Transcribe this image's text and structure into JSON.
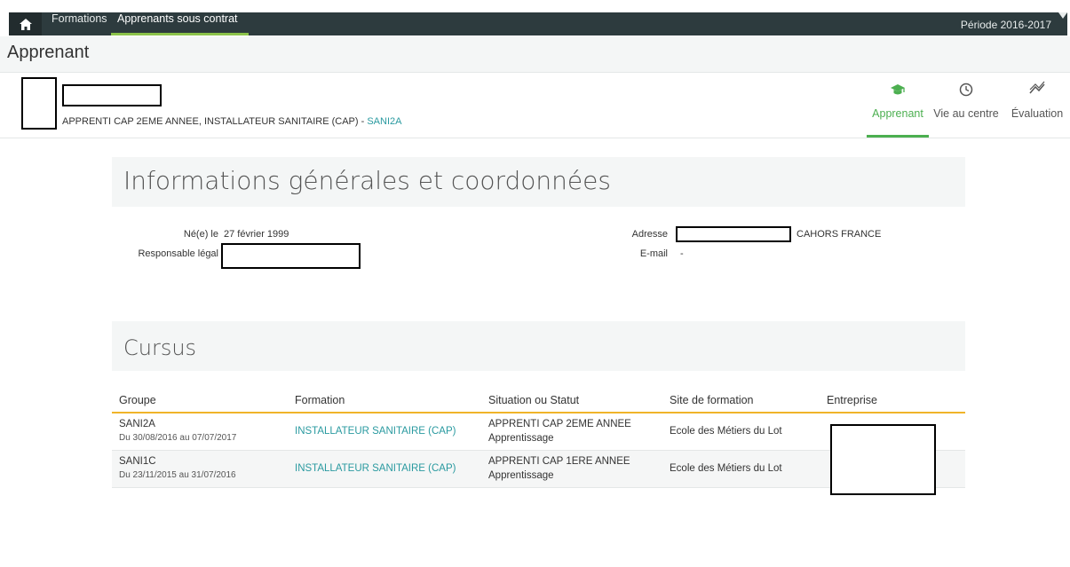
{
  "topnav": {
    "items": [
      "Formations",
      "Apprenants sous contrat"
    ],
    "period": "Période 2016-2017"
  },
  "page_title": "Apprenant",
  "learner": {
    "course_text": "APPRENTI CAP 2EME ANNEE, INSTALLATEUR SANITAIRE (CAP) - ",
    "group_code": "SANI2A"
  },
  "tabs": [
    {
      "label": "Apprenant",
      "icon": "graduation-cap-icon"
    },
    {
      "label": "Vie au centre",
      "icon": "clock-icon"
    },
    {
      "label": "Évaluation",
      "icon": "trend-icon"
    }
  ],
  "info": {
    "title": "Informations générales et coordonnées",
    "birth_label": "Né(e) le",
    "birth_value": "27 février 1999",
    "guardian_label": "Responsable légal",
    "address_label": "Adresse",
    "address_suffix": "CAHORS FRANCE",
    "email_label": "E-mail",
    "email_value": "-"
  },
  "cursus": {
    "title": "Cursus",
    "columns": [
      "Groupe",
      "Formation",
      "Situation ou Statut",
      "Site de formation",
      "Entreprise"
    ],
    "rows": [
      {
        "group": "SANI2A",
        "dates": "Du 30/08/2016 au 07/07/2017",
        "formation": "INSTALLATEUR SANITAIRE (CAP)",
        "status": "APPRENTI CAP 2EME ANNEE",
        "status_type": "Apprentissage",
        "site": "Ecole des Métiers du Lot"
      },
      {
        "group": "SANI1C",
        "dates": "Du 23/11/2015 au 31/07/2016",
        "formation": "INSTALLATEUR SANITAIRE (CAP)",
        "status": "APPRENTI CAP 1ERE ANNEE",
        "status_type": "Apprentissage",
        "site": "Ecole des Métiers du Lot"
      }
    ]
  },
  "colors": {
    "accent": "#4caf50",
    "link": "#2a9aa0",
    "table_rule": "#f0b429",
    "topbar": "#2d3b3e"
  }
}
